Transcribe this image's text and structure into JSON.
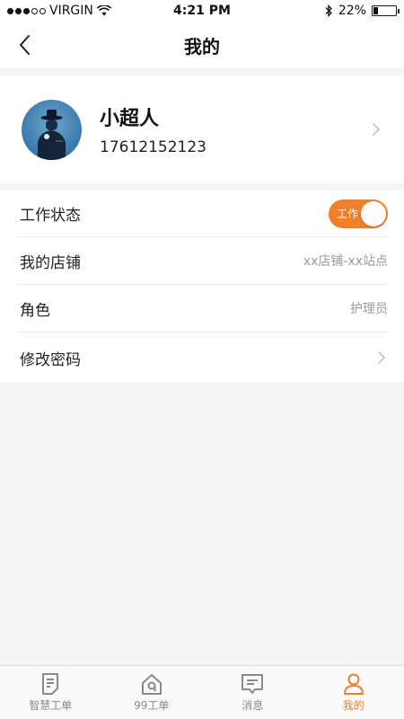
{
  "status_bar": {
    "carrier": "VIRGIN",
    "time": "4:21 PM",
    "battery": "22%",
    "battery_level": 0.22
  },
  "nav": {
    "title": "我的"
  },
  "profile": {
    "name": "小超人",
    "phone": "17612152123"
  },
  "settings": {
    "work_status": {
      "label": "工作状态",
      "toggle_text": "工作",
      "on": true
    },
    "store": {
      "label": "我的店铺",
      "value": "xx店铺-xx站点"
    },
    "role": {
      "label": "角色",
      "value": "护理员"
    },
    "change_password": {
      "label": "修改密码"
    }
  },
  "tabs": [
    {
      "label": "智慧工单",
      "icon": "document-icon",
      "active": false
    },
    {
      "label": "99工单",
      "icon": "home-icon",
      "active": false
    },
    {
      "label": "消息",
      "icon": "message-icon",
      "active": false
    },
    {
      "label": "我的",
      "icon": "user-icon",
      "active": true
    }
  ],
  "colors": {
    "accent": "#f07f2a",
    "background": "#f4f4f4"
  }
}
